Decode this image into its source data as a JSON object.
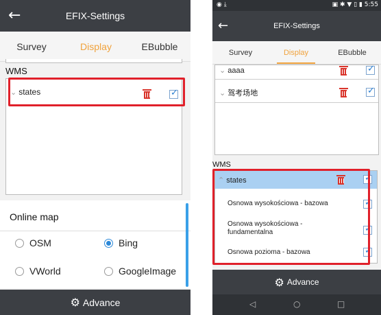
{
  "left": {
    "header": {
      "title": "EFIX-Settings",
      "back_icon": "arrow-left-icon"
    },
    "tabs": [
      {
        "label": "Survey",
        "active": false
      },
      {
        "label": "Display",
        "active": true
      },
      {
        "label": "EBubble",
        "active": false
      }
    ],
    "wms": {
      "label": "WMS",
      "items": [
        {
          "label": "states",
          "checked": true
        }
      ]
    },
    "online_map": {
      "heading": "Online map",
      "options": [
        {
          "label": "OSM",
          "selected": false
        },
        {
          "label": "Bing",
          "selected": true
        },
        {
          "label": "VWorld",
          "selected": false
        },
        {
          "label": "GoogleImage",
          "selected": false
        }
      ]
    },
    "footer": {
      "advance_label": "Advance",
      "icon": "gear-icon"
    }
  },
  "right": {
    "status_bar": {
      "left_icons": "◉ ⤓",
      "right_text": "▣ ✱ ▼ ▯ ▮ 5:55"
    },
    "header": {
      "title": "EFIX-Settings",
      "back_icon": "arrow-left-icon"
    },
    "tabs": [
      {
        "label": "Survey",
        "active": false
      },
      {
        "label": "Display",
        "active": true
      },
      {
        "label": "EBubble",
        "active": false
      }
    ],
    "layers": [
      {
        "label": "aaaa",
        "checked": true
      },
      {
        "label": "驾考场地",
        "checked": true
      }
    ],
    "wms": {
      "label": "WMS",
      "group": {
        "label": "states",
        "checked": true
      },
      "sublayers": [
        {
          "label": "Osnowa wysokościowa - bazowa",
          "checked": true
        },
        {
          "label": "Osnowa wysokościowa - fundamentalna",
          "checked": true
        },
        {
          "label": "Osnowa pozioma - bazowa",
          "checked": true
        }
      ]
    },
    "footer": {
      "advance_label": "Advance",
      "icon": "gear-icon"
    },
    "nav": {
      "back": "◁",
      "home": "○",
      "recents": "□"
    }
  },
  "colors": {
    "accent": "#f0a23c",
    "highlight": "#e0202a",
    "check": "#2b7fd1",
    "trash": "#d9342b",
    "bar": "#3c3f44"
  }
}
